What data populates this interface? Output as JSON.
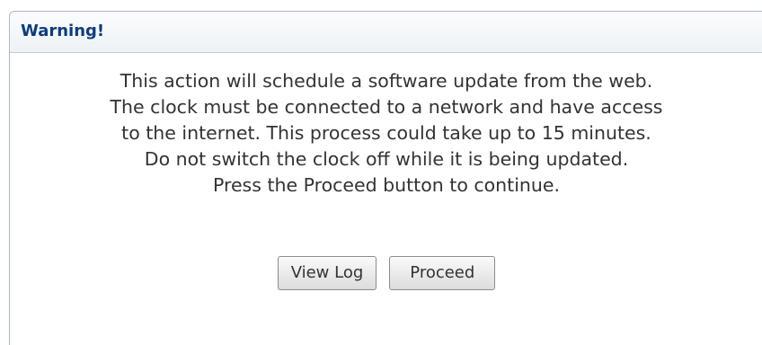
{
  "dialog": {
    "title": "Warning!",
    "message_lines": [
      "This action will schedule a software update from the web.",
      "The clock must be connected to a network and have access",
      "to the internet. This process could take up to 15 minutes.",
      "Do not switch the clock off while it is being updated.",
      "Press the Proceed button to continue."
    ],
    "buttons": {
      "view_log": "View Log",
      "proceed": "Proceed"
    }
  },
  "colors": {
    "title_text": "#0f3d7a",
    "border": "#a9b8c8",
    "body_text": "#333333"
  }
}
